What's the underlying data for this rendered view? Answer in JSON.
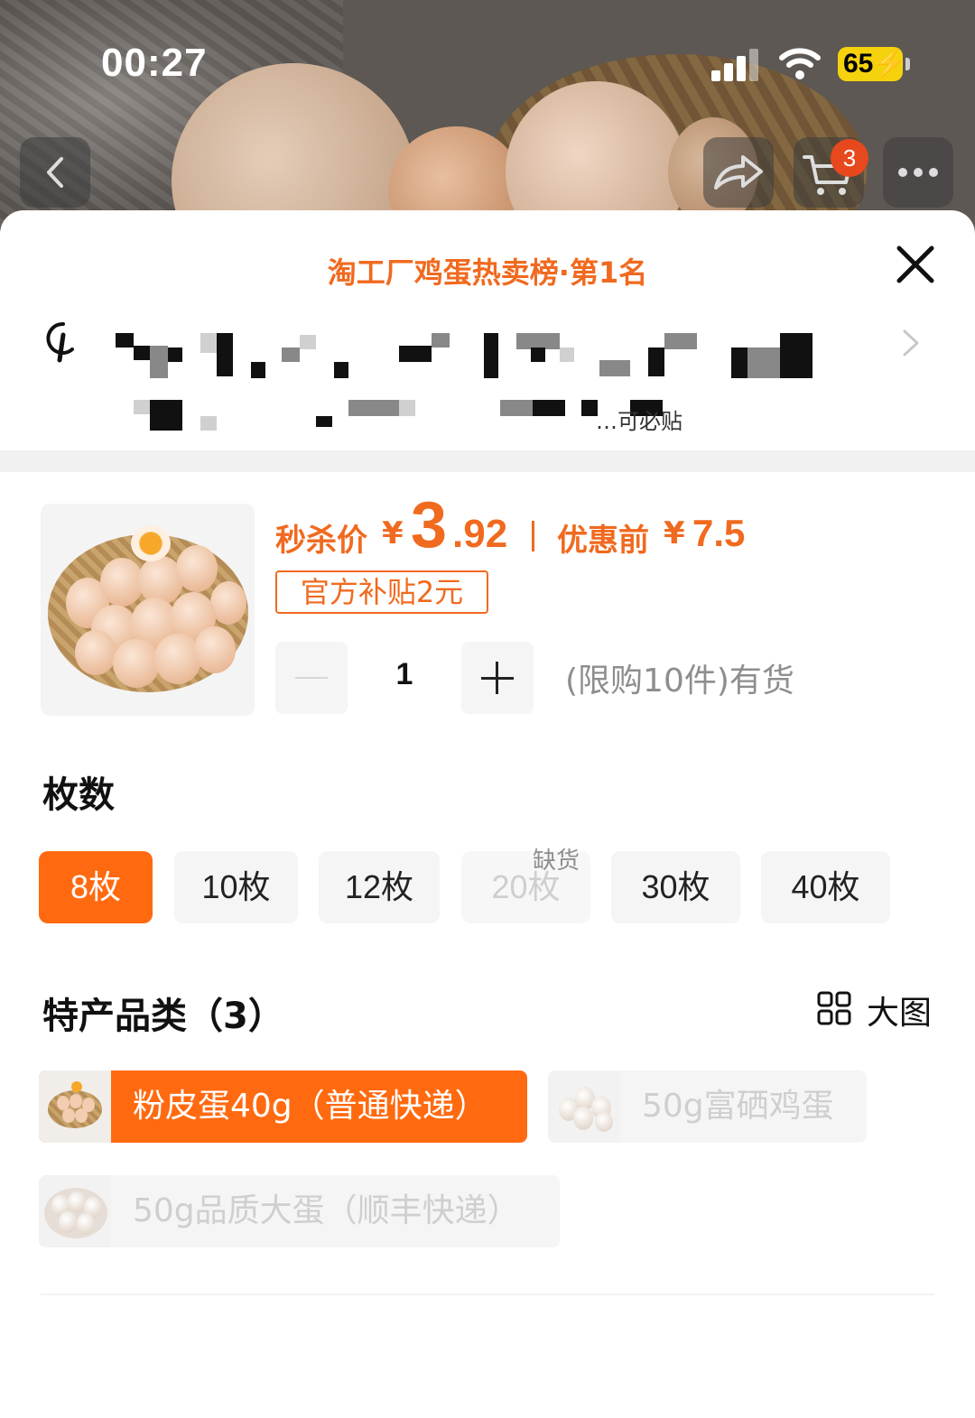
{
  "status_bar": {
    "time": "00:27",
    "battery": "65"
  },
  "nav": {
    "cart_badge": "3"
  },
  "sheet": {
    "ranking": "淘工厂鸡蛋热卖榜·第1名",
    "blur_tail": "…可必贴"
  },
  "product": {
    "price_label": "秒杀价",
    "currency": "¥",
    "price_int": "3",
    "price_dec": ".92",
    "orig_label": "优惠前",
    "orig_price": "7.5",
    "subsidy": "官方补贴2元",
    "quantity": "1",
    "stock_note": "(限购10件)有货"
  },
  "count_section": {
    "title": "枚数",
    "options": [
      {
        "label": "8枚",
        "state": "selected"
      },
      {
        "label": "10枚",
        "state": "normal"
      },
      {
        "label": "12枚",
        "state": "normal"
      },
      {
        "label": "20枚",
        "state": "out_of_stock",
        "tag": "缺货"
      },
      {
        "label": "30枚",
        "state": "normal"
      },
      {
        "label": "40枚",
        "state": "normal"
      }
    ]
  },
  "category_section": {
    "title": "特产品类（3）",
    "view_toggle": "大图",
    "items": [
      {
        "label": "粉皮蛋40g（普通快递）",
        "state": "selected"
      },
      {
        "label": "50g富硒鸡蛋",
        "state": "disabled"
      },
      {
        "label": "50g品质大蛋（顺丰快递）",
        "state": "disabled"
      }
    ]
  },
  "colors": {
    "accent": "#ff6a10",
    "price": "#f06a1f",
    "disabled_text": "#cfcfcf"
  }
}
